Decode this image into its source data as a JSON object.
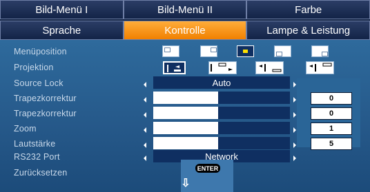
{
  "tabs_row1": [
    "Bild-Menü I",
    "Bild-Menü II",
    "Farbe"
  ],
  "tabs_row2": [
    "Sprache",
    "Kontrolle",
    "Lampe & Leistung"
  ],
  "labels": {
    "menu_position": "Menüposition",
    "projection": "Projektion",
    "source_lock": "Source Lock",
    "keystone_h": "Trapezkorrektur",
    "keystone_v": "Trapezkorrektur",
    "zoom": "Zoom",
    "volume": "Lautstärke",
    "rs232": "RS232 Port",
    "reset": "Zurücksetzen"
  },
  "values": {
    "source_lock": "Auto",
    "rs232": "Network",
    "keystone_h": "0",
    "keystone_v": "0",
    "zoom": "1",
    "volume": "5"
  },
  "enter_label": "ENTER"
}
